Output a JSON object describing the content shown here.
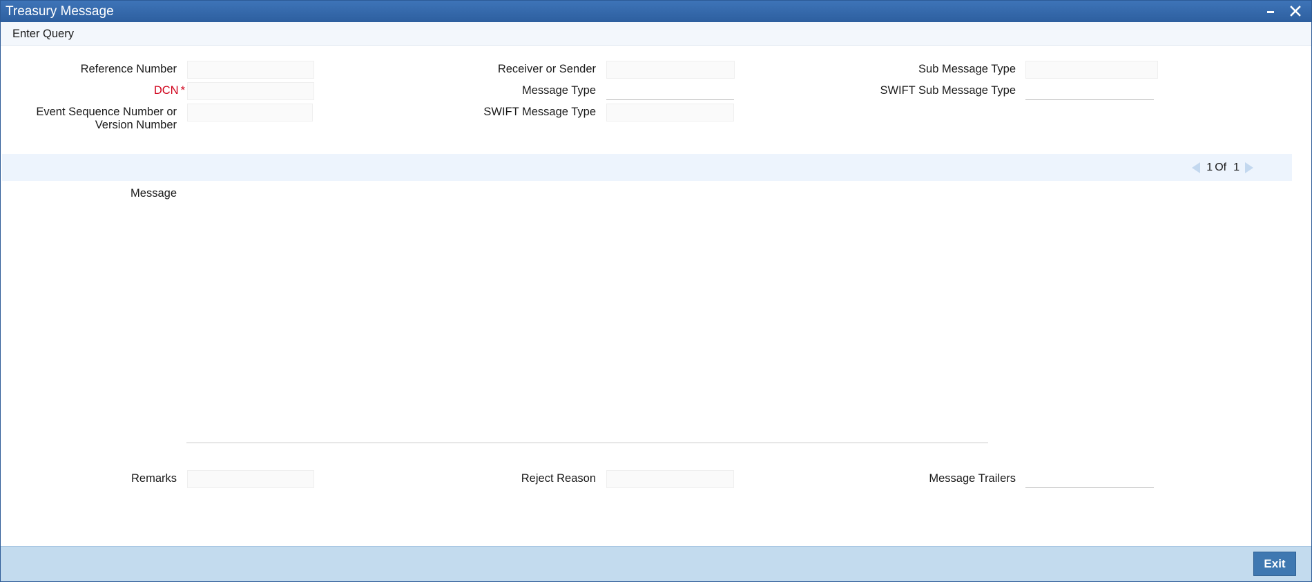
{
  "window": {
    "title": "Treasury Message",
    "minimize_icon": "minimize-icon",
    "close_icon": "close-icon"
  },
  "toolbar": {
    "enter_query": "Enter Query"
  },
  "form": {
    "reference_number": {
      "label": "Reference Number",
      "value": ""
    },
    "dcn": {
      "label": "DCN",
      "required_marker": "*",
      "value": ""
    },
    "event_sequence": {
      "label_line1": "Event Sequence Number or",
      "label_line2": "Version Number",
      "value": ""
    },
    "receiver_or_sender": {
      "label": "Receiver or Sender",
      "value": ""
    },
    "message_type": {
      "label": "Message Type",
      "value": ""
    },
    "swift_message_type": {
      "label": "SWIFT Message Type",
      "value": ""
    },
    "sub_message_type": {
      "label": "Sub Message Type",
      "value": ""
    },
    "swift_sub_message_type": {
      "label": "SWIFT Sub Message Type",
      "value": ""
    }
  },
  "pager": {
    "current": "1",
    "of_label": "Of",
    "total": "1",
    "prev_icon": "triangle-left-icon",
    "next_icon": "triangle-right-icon"
  },
  "message": {
    "label": "Message",
    "value": ""
  },
  "bottom": {
    "remarks": {
      "label": "Remarks",
      "value": ""
    },
    "reject_reason": {
      "label": "Reject Reason",
      "value": ""
    },
    "message_trailers": {
      "label": "Message Trailers",
      "value": ""
    }
  },
  "footer": {
    "exit_label": "Exit"
  },
  "colors": {
    "titlebar": "#2d5f9f",
    "required": "#d0021b",
    "footer": "#c3dbee",
    "exit_button": "#3f78b1"
  }
}
